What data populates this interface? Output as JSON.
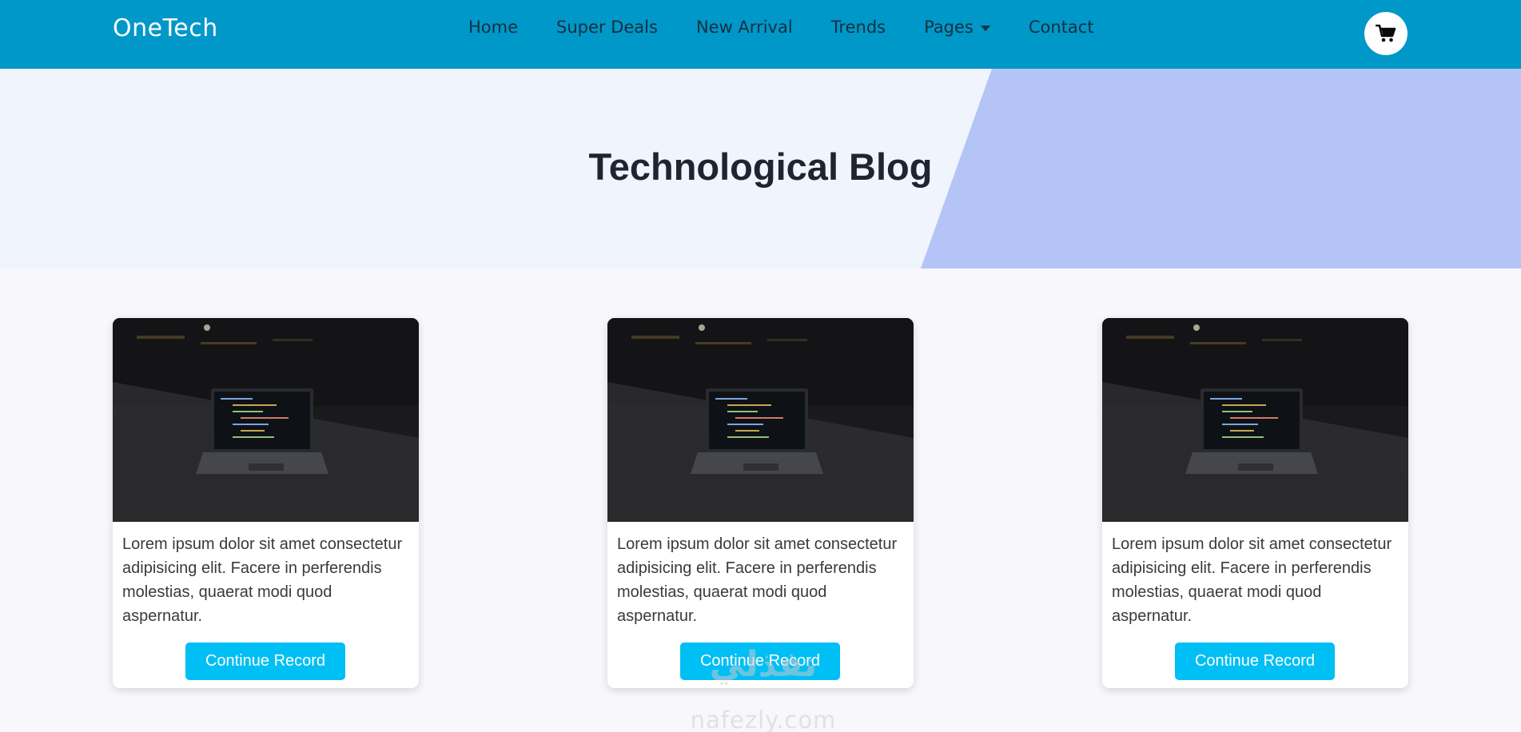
{
  "navbar": {
    "brand": "OneTech",
    "links": [
      "Home",
      "Super Deals",
      "New Arrival",
      "Trends",
      "Pages",
      "Contact"
    ],
    "cart_icon": "shopping-cart-icon",
    "background_color": "#0097c9"
  },
  "hero": {
    "title": "Technological Blog",
    "background_color": "#eff4fd",
    "accent_color": "#b4c4f7"
  },
  "cards": [
    {
      "image_icon": "laptop-photo",
      "text": "Lorem ipsum dolor sit amet consectetur adipisicing elit. Facere in perferendis molestias, quaerat modi quod aspernatur.",
      "button_label": "Continue Record"
    },
    {
      "image_icon": "laptop-photo",
      "text": "Lorem ipsum dolor sit amet consectetur adipisicing elit. Facere in perferendis molestias, quaerat modi quod aspernatur.",
      "button_label": "Continue Record"
    },
    {
      "image_icon": "laptop-photo",
      "text": "Lorem ipsum dolor sit amet consectetur adipisicing elit. Facere in perferendis molestias, quaerat modi quod aspernatur.",
      "button_label": "Continue Record"
    }
  ],
  "button_color": "#00bff4",
  "watermark": {
    "logo_text": "نفذلي",
    "text": "nafezly.com"
  }
}
